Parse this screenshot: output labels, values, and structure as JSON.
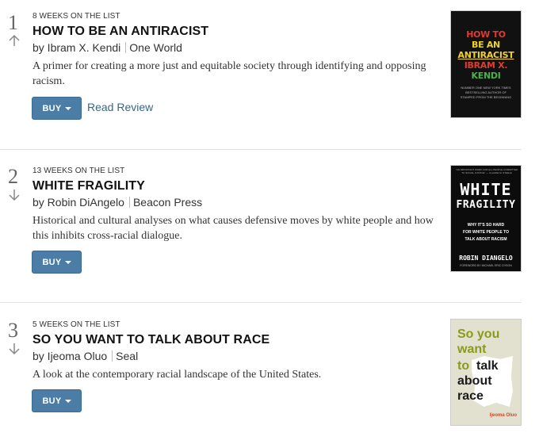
{
  "books": [
    {
      "rank": "1",
      "trend": "up",
      "weeks": "8 WEEKS ON THE LIST",
      "title": "HOW TO BE AN ANTIRACIST",
      "author": "by Ibram X. Kendi",
      "publisher": "One World",
      "description": "A primer for creating a more just and equitable society through identifying and opposing racism.",
      "buy_label": "BUY",
      "review_label": "Read Review",
      "cover": {
        "lines": [
          "HOW TO",
          "BE AN",
          "ANTIRACIST",
          "IBRAM X.",
          "KENDI"
        ],
        "colors": [
          "#e23a2e",
          "#f0d21f",
          "#f0d21f",
          "#e23a2e",
          "#49b04a"
        ],
        "small": "NUMBER ONE NEW YORK TIMES BESTSELLING AUTHOR OF STAMPED FROM THE BEGINNING"
      }
    },
    {
      "rank": "2",
      "trend": "down",
      "weeks": "13 WEEKS ON THE LIST",
      "title": "WHITE FRAGILITY",
      "author": "by Robin DiAngelo",
      "publisher": "Beacon Press",
      "description": "Historical and cultural analyses on what causes defensive moves by white people and how this inhibits cross-racial dialogue.",
      "buy_label": "BUY",
      "cover": {
        "top": "\"AN IMPORTANT WORK FOR ALL PEOPLE COMMITTED TO SOCIAL JUSTICE\" — CLAUDE M. STEELE",
        "title1": "WHITE",
        "title2": "FRAGILITY",
        "sub1": "WHY IT'S SO HARD",
        "sub2": "FOR WHITE PEOPLE TO",
        "sub3": "TALK ABOUT RACISM",
        "author": "ROBIN DIANGELO",
        "foreword": "FOREWORD BY MICHAEL ERIC DYSON"
      }
    },
    {
      "rank": "3",
      "trend": "down",
      "weeks": "5 WEEKS ON THE LIST",
      "title": "SO YOU WANT TO TALK ABOUT RACE",
      "author": "by Ijeoma Oluo",
      "publisher": "Seal",
      "description": "A look at the contemporary racial landscape of the United States.",
      "buy_label": "BUY",
      "cover": {
        "so_you": "So you",
        "want": "want",
        "to": "to",
        "talk": "talk",
        "about": "about",
        "race": "race",
        "author": "Ijeoma Oluo"
      }
    }
  ],
  "colors": {
    "buy": "#4b7da6",
    "link": "#326891",
    "cover3_green": "#8a9a1a"
  }
}
